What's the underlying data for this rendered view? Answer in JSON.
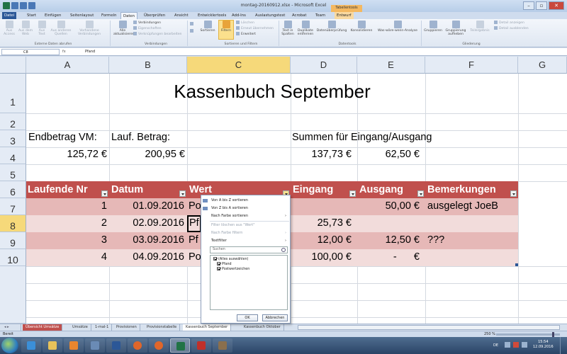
{
  "window": {
    "title": "montag-20160912.xlsx - Microsoft Excel",
    "contextual_group": "Tabellentools"
  },
  "ribbon_tabs": [
    "Datei",
    "Start",
    "Einfügen",
    "Seitenlayout",
    "Formeln",
    "Daten",
    "Überprüfen",
    "Ansicht",
    "Entwicklertools",
    "Add-Ins",
    "Auslastungstest",
    "Acrobat",
    "Team",
    "Entwurf"
  ],
  "active_tab": "Daten",
  "ribbon": {
    "external": {
      "access": "Aus Access",
      "web": "Aus dem Web",
      "text": "Aus Text",
      "other": "Aus anderen Quellen",
      "existing": "Vorhandene Verbindungen",
      "group": "Externe Daten abrufen"
    },
    "connections": {
      "refresh": "Alle aktualisieren",
      "conn": "Verbindungen",
      "props": "Eigenschaften",
      "links": "Verknüpfungen bearbeiten",
      "group": "Verbindungen"
    },
    "sort": {
      "sort": "Sortieren",
      "filter": "Filtern",
      "clear": "Löschen",
      "reapply": "Erneut übernehmen",
      "advanced": "Erweitert",
      "group": "Sortieren und Filtern"
    },
    "tools": {
      "t2c": "Text in Spalten",
      "dup": "Duplikate entfernen",
      "valid": "Datenüberprüfung",
      "consol": "Konsolidieren",
      "whatif": "Was-wäre-wenn-Analyse",
      "group": "Datentools"
    },
    "outline": {
      "group_btn": "Gruppieren",
      "ungroup": "Gruppierung aufheben",
      "subtotal": "Teilergebnis",
      "show": "Detail anzeigen",
      "hide": "Detail ausblenden",
      "group": "Gliederung"
    }
  },
  "formula_bar": {
    "name_box": "C8",
    "fx": "fx",
    "content": "Pfand"
  },
  "columns": [
    "A",
    "B",
    "C",
    "D",
    "E",
    "F",
    "G"
  ],
  "rows": [
    "1",
    "2",
    "3",
    "4",
    "5",
    "6",
    "7",
    "8",
    "9",
    "10"
  ],
  "sheet": {
    "title": "Kassenbuch September",
    "r3": {
      "a": "Endbetrag VM:",
      "b": "Lauf. Betrag:",
      "d": "Summen für Eingang/Ausgang"
    },
    "r4": {
      "a": "125,72 €",
      "b": "200,95 €",
      "d": "137,73 €",
      "e": "62,50 €"
    },
    "headers": [
      "Laufende Nr",
      "Datum",
      "Wert",
      "Eingang",
      "Ausgang",
      "Bemerkungen"
    ],
    "data": [
      {
        "nr": "1",
        "datum": "01.09.2016",
        "wert": "Po",
        "eingang": "",
        "ausgang": "50,00 €",
        "bem": "ausgelegt JoeB"
      },
      {
        "nr": "2",
        "datum": "02.09.2016",
        "wert": "Pf",
        "eingang": "25,73 €",
        "ausgang": "",
        "bem": ""
      },
      {
        "nr": "3",
        "datum": "03.09.2016",
        "wert": "Pf",
        "eingang": "12,00 €",
        "ausgang": "12,50 €",
        "bem": "???"
      },
      {
        "nr": "4",
        "datum": "04.09.2016",
        "wert": "Po",
        "eingang": "100,00 €",
        "ausgang": "-      €",
        "bem": ""
      }
    ]
  },
  "filter_menu": {
    "sort_az": "Von A bis Z sortieren",
    "sort_za": "Von Z bis A sortieren",
    "sort_color": "Nach Farbe sortieren",
    "clear": "Filter löschen aus \"Wert\"",
    "color_filter": "Nach Farbe filtern",
    "text_filter": "Textfilter",
    "search_placeholder": "Suchen",
    "items": [
      "(Alles auswählen)",
      "Pfand",
      "Postwertzeichen"
    ],
    "ok": "OK",
    "cancel": "Abbrechen"
  },
  "sheet_tabs": [
    "Übersicht Umsätze",
    "Umsätze",
    "1-mal-1",
    "Provisionen",
    "Provisionstabelle",
    "Kassenbuch September",
    "Kassenbuch Oktober"
  ],
  "active_sheet": "Kassenbuch September",
  "status": {
    "ready": "Bereit",
    "zoom": "250 %"
  },
  "taskbar": {
    "lang": "DE",
    "time": "15:54",
    "date": "12.09.2016"
  },
  "colors": {
    "header_band": "#c0504d",
    "band_dark": "#e6b8b7",
    "band_light": "#f2dcdb",
    "selection": "#f6d97a"
  }
}
